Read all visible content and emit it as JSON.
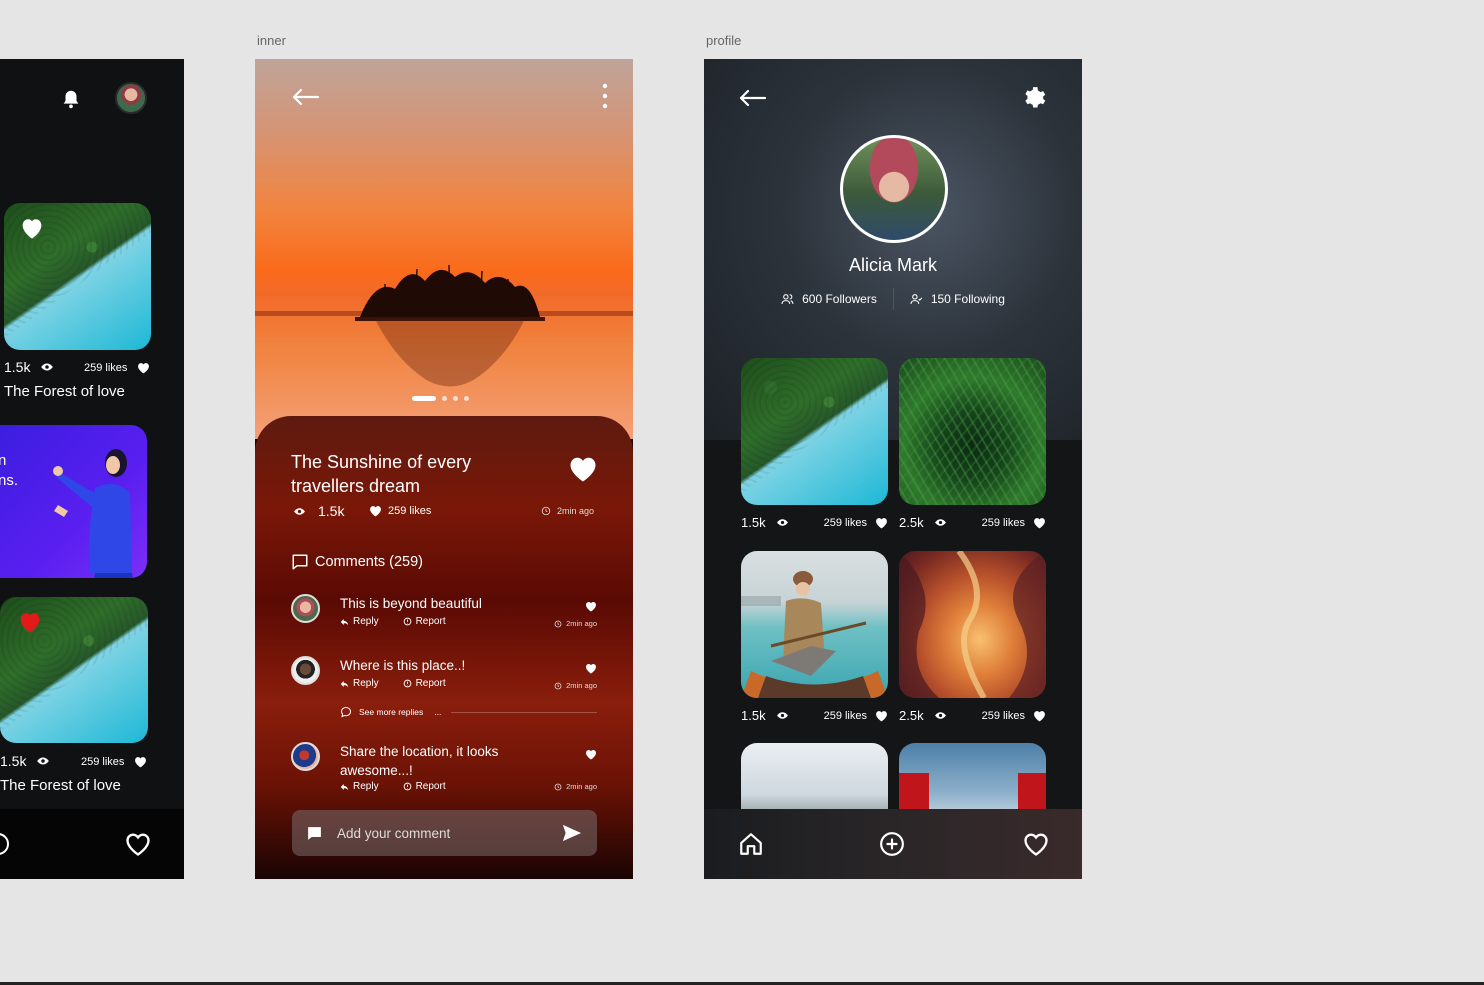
{
  "canvas": {
    "labels": {
      "inner": "inner",
      "profile": "profile"
    }
  },
  "feed": {
    "cards": [
      {
        "views": "1.5k",
        "likes": "259 likes",
        "title": "The Forest of love"
      },
      {
        "views": "1.5k",
        "likes": "259 likes",
        "title": "The Forest of love"
      }
    ],
    "illustration_text": [
      "n",
      "ns."
    ],
    "icons": {
      "bell": "bell-icon",
      "heart": "heart-icon",
      "eye": "eye-icon"
    }
  },
  "inner": {
    "title": "The Sunshine of every travellers dream",
    "views": "1.5k",
    "likes": "259 likes",
    "time": "2min ago",
    "comments_header": "Comments (259)",
    "comments": [
      {
        "text": "This is beyond beautiful",
        "reply": "Reply",
        "report": "Report",
        "time": "2min ago"
      },
      {
        "text": "Where is this place..!",
        "reply": "Reply",
        "report": "Report",
        "time": "2min ago"
      },
      {
        "text": "Share the location, it looks awesome...!",
        "reply": "Reply",
        "report": "Report",
        "time": "2min ago"
      }
    ],
    "see_more": "See more replies",
    "input_placeholder": "Add your comment",
    "slider": {
      "total": 4,
      "active": 1
    },
    "colors": {
      "accent_red": "#7a1808",
      "sunset": "#fa6a1a"
    }
  },
  "profile": {
    "name": "Alicia Mark",
    "followers": "600 Followers",
    "following": "150 Following",
    "grid": [
      {
        "views": "1.5k",
        "likes": "259 likes"
      },
      {
        "views": "2.5k",
        "likes": "259 likes"
      },
      {
        "views": "1.5k",
        "likes": "259 likes"
      },
      {
        "views": "2.5k",
        "likes": "259 likes"
      }
    ],
    "icons": {
      "back": "arrow-left-icon",
      "settings": "gear-icon",
      "home": "home-icon",
      "add": "plus-circle-icon",
      "heart": "heart-outline-icon"
    }
  }
}
